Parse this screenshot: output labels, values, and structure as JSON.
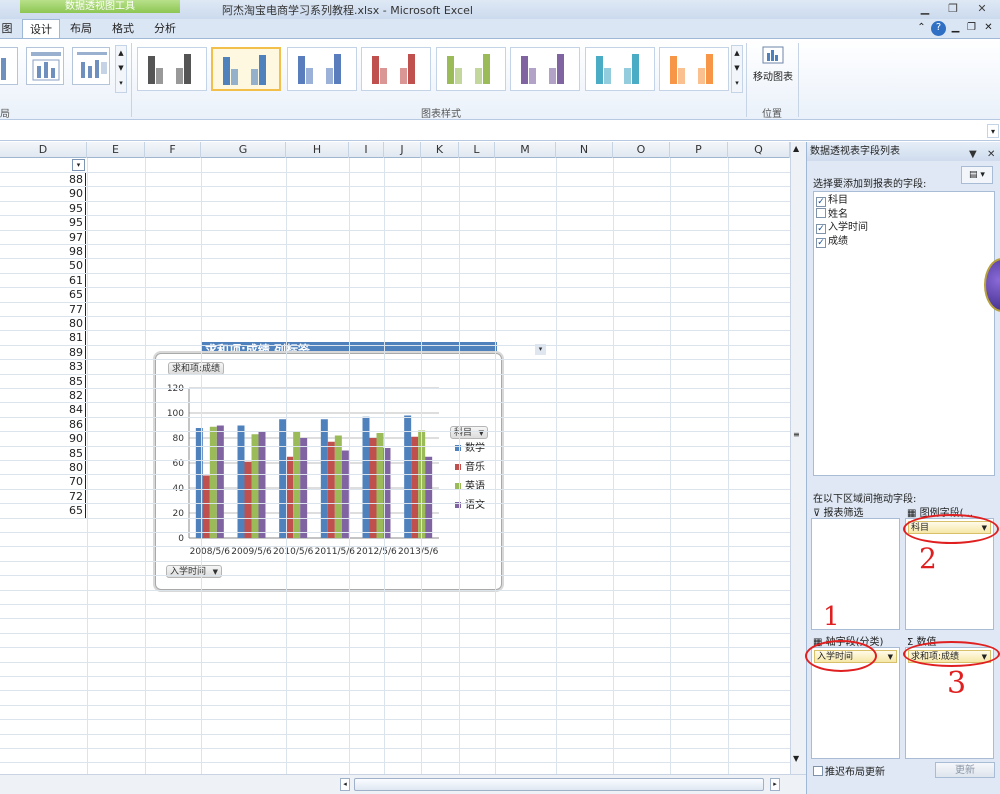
{
  "window": {
    "contextual_group": "数据透视图工具",
    "title": "阿杰淘宝电商学习系列教程.xlsx - Microsoft Excel",
    "controls": [
      "minimize-icon",
      "restore-icon",
      "close-icon"
    ]
  },
  "ribbon": {
    "tabs": [
      {
        "label": "图",
        "active": false
      },
      {
        "label": "设计",
        "active": true
      },
      {
        "label": "布局",
        "active": false
      },
      {
        "label": "格式",
        "active": false
      },
      {
        "label": "分析",
        "active": false
      }
    ],
    "group_left_label": "局",
    "group_styles_label": "图表样式",
    "group_location_label": "位置",
    "move_chart_label": "移动图表",
    "style_colors": [
      "#555555",
      "#4f81bd",
      "#5a7dbd",
      "#c0504d",
      "#9bbb59",
      "#8064a2",
      "#4bacc6",
      "#f79646"
    ]
  },
  "sheet": {
    "columns": [
      "D",
      "E",
      "F",
      "G",
      "H",
      "I",
      "J",
      "K",
      "L",
      "M",
      "N",
      "O",
      "P",
      "Q"
    ],
    "column_d_values": [
      "88",
      "90",
      "95",
      "95",
      "97",
      "98",
      "50",
      "61",
      "65",
      "77",
      "80",
      "81",
      "89",
      "83",
      "85",
      "82",
      "84",
      "86",
      "90",
      "85",
      "80",
      "70",
      "72",
      "65"
    ],
    "pivot_header": "求和项:成绩    列标签"
  },
  "chart": {
    "value_chip": "求和项:成绩",
    "axis_chip": "入学时间",
    "legend_chip": "科目",
    "chart_data": {
      "type": "bar",
      "categories": [
        "2008/5/6",
        "2009/5/6",
        "2010/5/6",
        "2011/5/6",
        "2012/5/6",
        "2013/5/6"
      ],
      "category_labels_shown": [
        "2008/5/6",
        "2009/5/6",
        "2010/5/6",
        "2011/5/6",
        "2012/5/6",
        "2013/5/6"
      ],
      "series": [
        {
          "name": "数学",
          "color": "#4f81bd",
          "values": [
            88,
            90,
            95,
            95,
            97,
            98
          ]
        },
        {
          "name": "音乐",
          "color": "#c0504d",
          "values": [
            50,
            61,
            65,
            77,
            80,
            81
          ]
        },
        {
          "name": "英语",
          "color": "#9bbb59",
          "values": [
            89,
            83,
            85,
            82,
            84,
            86
          ]
        },
        {
          "name": "语文",
          "color": "#8064a2",
          "values": [
            90,
            85,
            80,
            70,
            72,
            65
          ]
        }
      ],
      "ylim": [
        0,
        120
      ],
      "yticks": [
        0,
        20,
        40,
        60,
        80,
        100,
        120
      ],
      "grid": true,
      "legend": "right"
    }
  },
  "pane": {
    "title": "数据透视表字段列表",
    "choose_label": "选择要添加到报表的字段:",
    "fields": [
      {
        "label": "科目",
        "checked": true
      },
      {
        "label": "姓名",
        "checked": false
      },
      {
        "label": "入学时间",
        "checked": true
      },
      {
        "label": "成绩",
        "checked": true
      }
    ],
    "drag_label": "在以下区域间拖动字段:",
    "zone_filter": "报表筛选",
    "zone_legend": "图例字段(...",
    "zone_axis": "轴字段(分类)",
    "zone_values": "数值",
    "legend_pill": "科目",
    "axis_pill": "入学时间",
    "values_pill": "求和项:成绩",
    "defer_label": "推迟布局更新",
    "update_label": "更新",
    "annotations": [
      "1",
      "2",
      "3"
    ]
  }
}
